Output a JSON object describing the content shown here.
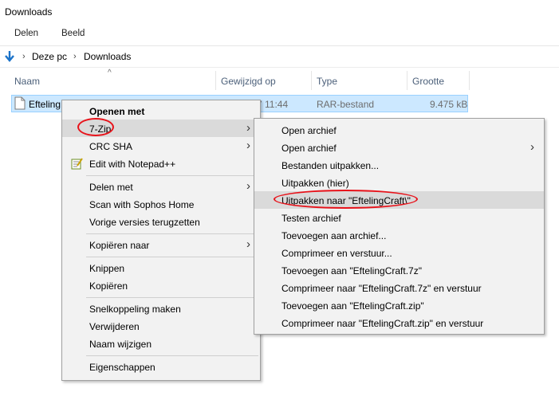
{
  "window": {
    "title": "Downloads"
  },
  "ribbon": {
    "tabs": [
      "Delen",
      "Beeld"
    ]
  },
  "address": {
    "crumbs": [
      "Deze pc",
      "Downloads"
    ]
  },
  "columns": {
    "name": "Naam",
    "modified": "Gewijzigd op",
    "type": "Type",
    "size": "Grootte"
  },
  "file": {
    "name": "Efteling",
    "modified": "7 11:44",
    "type": "RAR-bestand",
    "size": "9.475 kB"
  },
  "context_menu": {
    "open_with": "Openen met",
    "seven_zip": "7-Zip",
    "crc_sha": "CRC SHA",
    "notepad": "Edit with Notepad++",
    "share_with": "Delen met",
    "sophos": "Scan with Sophos Home",
    "restore": "Vorige versies terugzetten",
    "copy_to": "Kopiëren naar",
    "cut": "Knippen",
    "copy": "Kopiëren",
    "shortcut": "Snelkoppeling maken",
    "delete": "Verwijderen",
    "rename": "Naam wijzigen",
    "properties": "Eigenschappen"
  },
  "submenu_7zip": {
    "items": [
      "Open archief",
      "Open archief",
      "Bestanden uitpakken...",
      "Uitpakken (hier)",
      "Uitpakken naar \"EftelingCraft\\\"",
      "Testen archief",
      "Toevoegen aan archief...",
      "Comprimeer en verstuur...",
      "Toevoegen aan \"EftelingCraft.7z\"",
      "Comprimeer naar \"EftelingCraft.7z\" en verstuur",
      "Toevoegen aan \"EftelingCraft.zip\"",
      "Comprimeer naar \"EftelingCraft.zip\" en verstuur"
    ]
  },
  "colors": {
    "highlight_circle": "#e8121a",
    "selection": "#cce8ff",
    "menu_bg": "#f2f2f2"
  },
  "icons": [
    "down-arrow-icon",
    "chevron-right-icon",
    "file-icon",
    "notepad-icon",
    "sort-up-icon"
  ]
}
